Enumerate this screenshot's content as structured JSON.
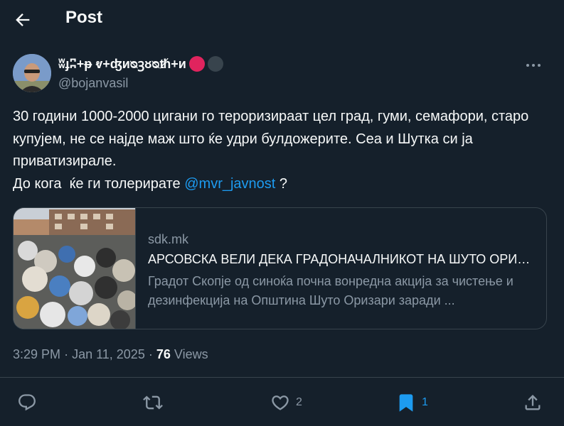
{
  "header": {
    "title": "Post"
  },
  "author": {
    "display_name": "ʬɟʭ+ᵽ ⱴ+ʤᴎᴓꝫᴕᴓᵺ+ᴎ",
    "handle": "@bojanvasil"
  },
  "tweet": {
    "text_part1": "30 години 1000-2000 цигани го тероризираат цел град, гуми, семафори, старо купујем, не се најде маж што ќе удри булдожерите. Сеа и Шутка си ја приватизирале.",
    "text_part2": "До кога  ќе ги толерирате ",
    "mention": "@mvr_javnost",
    "text_part3": " ?"
  },
  "card": {
    "domain": "sdk.mk",
    "title": "АРСОВСКА ВЕЛИ ДЕКА ГРАДОНАЧАЛНИКОТ НА ШУТО ОРИЗАРИ...",
    "description": "Градот Скопје од синоќа почна вонредна акција за чистење и дезинфекција на Општина Шуто Оризари заради ..."
  },
  "meta": {
    "time": "3:29 PM",
    "separator": "·",
    "date": "Jan 11, 2025",
    "views_count": "76",
    "views_label": "Views"
  },
  "actions": {
    "likes_count": "2",
    "bookmarks_count": "1"
  },
  "colors": {
    "background": "#15202b",
    "accent": "#1d9bf0",
    "secondary_text": "#8b98a5",
    "border": "#38444d"
  },
  "icons": [
    "back-arrow-icon",
    "more-icon",
    "reply-icon",
    "repost-icon",
    "like-icon",
    "bookmark-icon",
    "share-icon"
  ]
}
